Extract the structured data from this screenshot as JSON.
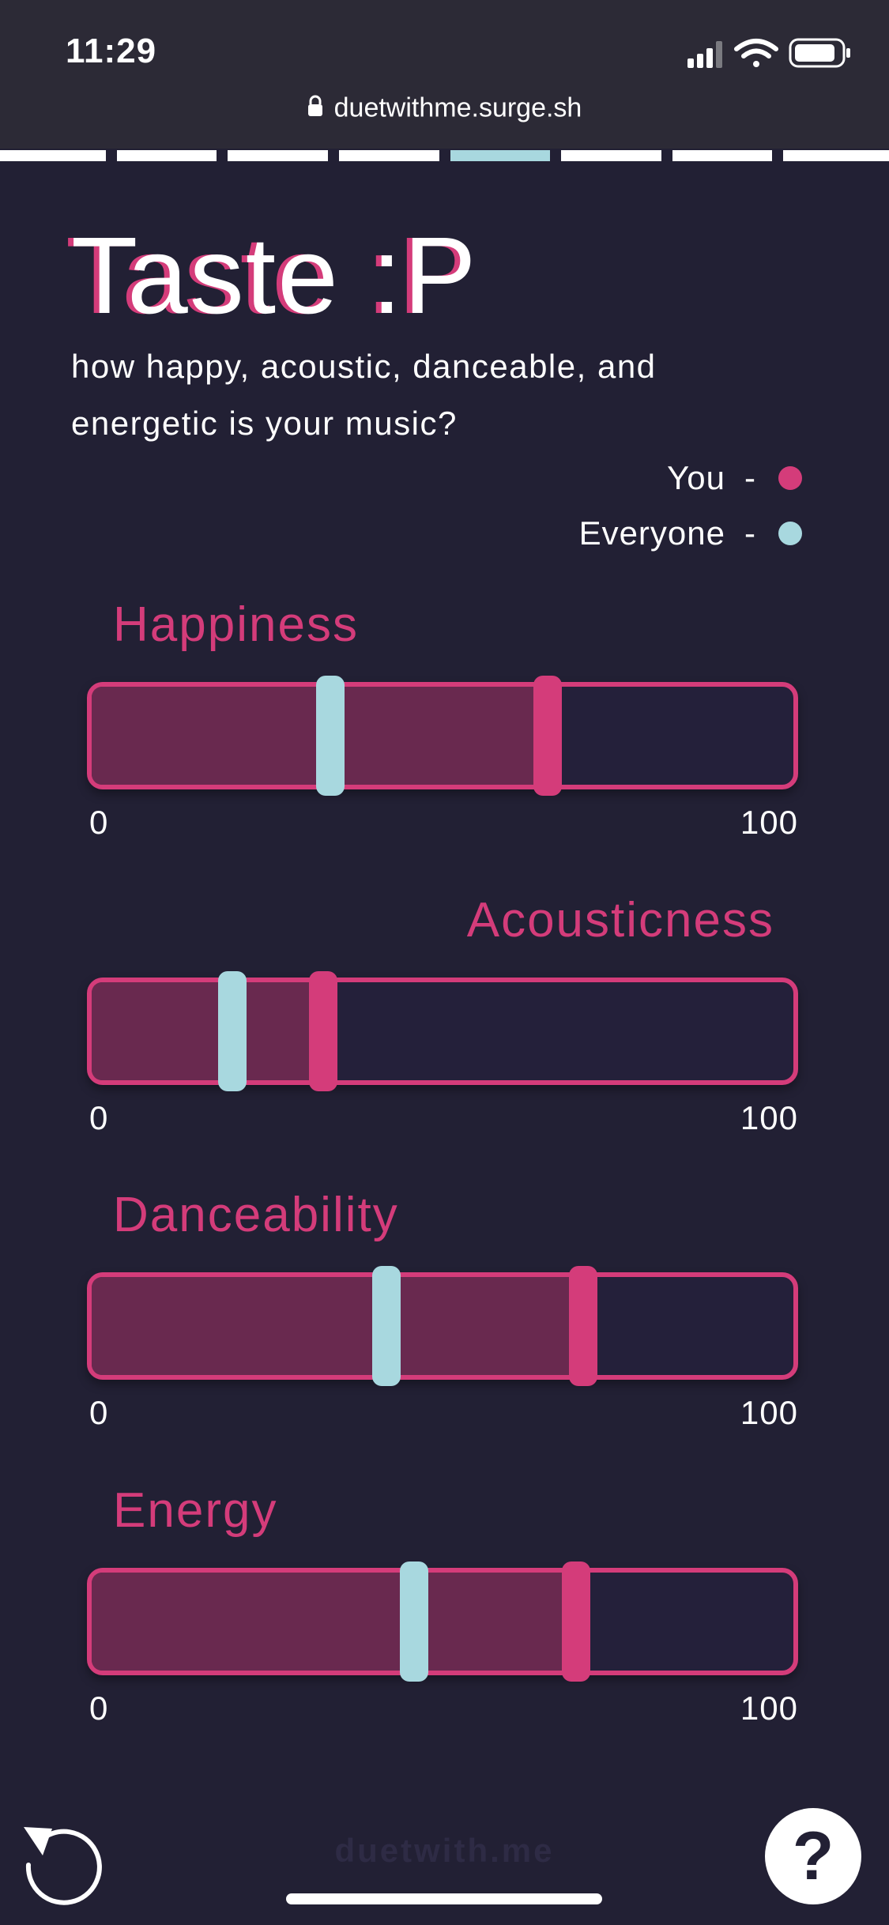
{
  "status_bar": {
    "time": "11:29",
    "icons": [
      "cellular-signal-icon",
      "wifi-icon",
      "battery-icon"
    ]
  },
  "browser": {
    "url": "duetwithme.surge.sh"
  },
  "progress": {
    "total_steps": 8,
    "current_step": 5
  },
  "page": {
    "title": "Taste :P",
    "subtitle": "how happy, acoustic, danceable, and energetic is your music?"
  },
  "legend": {
    "you_label": "You",
    "everyone_label": "Everyone",
    "dash": "-"
  },
  "colors": {
    "background": "#222034",
    "accent_pink": "#d43c7a",
    "fill_pink": "#69294f",
    "accent_cyan": "#a8d8df"
  },
  "metrics": [
    {
      "label": "Happiness",
      "align": "left",
      "you": 65,
      "everyone": 34,
      "min": "0",
      "max": "100"
    },
    {
      "label": "Acousticness",
      "align": "right",
      "you": 33,
      "everyone": 20,
      "min": "0",
      "max": "100"
    },
    {
      "label": "Danceability",
      "align": "left",
      "you": 70,
      "everyone": 42,
      "min": "0",
      "max": "100"
    },
    {
      "label": "Energy",
      "align": "left",
      "you": 69,
      "everyone": 46,
      "min": "0",
      "max": "100"
    }
  ],
  "footer": {
    "brand": "duetwith.me",
    "help_label": "?"
  }
}
